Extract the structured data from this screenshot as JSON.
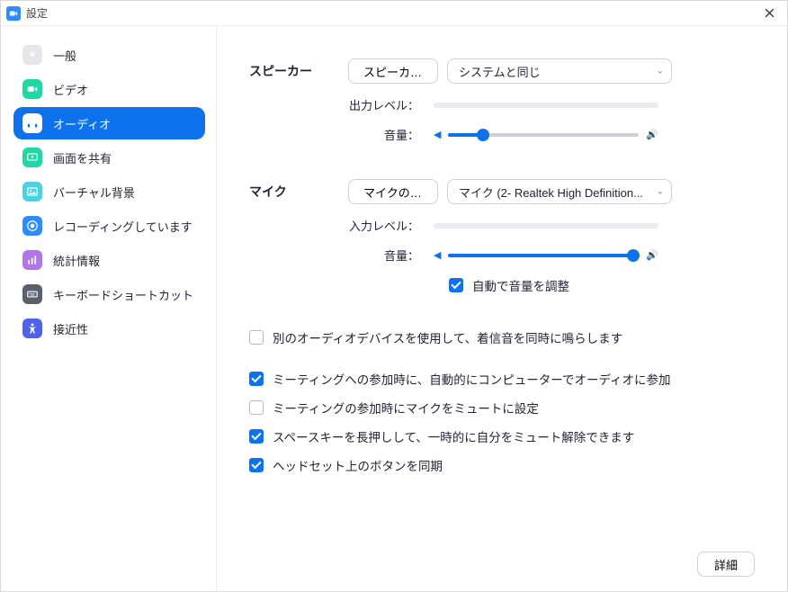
{
  "titlebar": {
    "title": "設定"
  },
  "sidebar": {
    "items": [
      {
        "label": "一般"
      },
      {
        "label": "ビデオ"
      },
      {
        "label": "オーディオ"
      },
      {
        "label": "画面を共有"
      },
      {
        "label": "バーチャル背景"
      },
      {
        "label": "レコーディングしています"
      },
      {
        "label": "統計情報"
      },
      {
        "label": "キーボードショートカット"
      },
      {
        "label": "接近性"
      }
    ]
  },
  "speaker": {
    "section": "スピーカー",
    "testButton": "スピーカー...",
    "device": "システムと同じ",
    "outputLevelLabel": "出力レベル：",
    "volumeLabel": "音量：",
    "volume": 18
  },
  "mic": {
    "section": "マイク",
    "testButton": "マイクのテ...",
    "device": "マイク (2- Realtek High Definition...",
    "inputLevelLabel": "入力レベル：",
    "volumeLabel": "音量：",
    "volume": 97,
    "autoAdjust": {
      "checked": true,
      "label": "自動で音量を調整"
    }
  },
  "options": {
    "ringSeparate": {
      "checked": false,
      "label": "別のオーディオデバイスを使用して、着信音を同時に鳴らします"
    },
    "autoJoin": {
      "checked": true,
      "label": "ミーティングへの参加時に、自動的にコンピューターでオーディオに参加"
    },
    "muteOnJoin": {
      "checked": false,
      "label": "ミーティングの参加時にマイクをミュートに設定"
    },
    "pushToTalk": {
      "checked": true,
      "label": "スペースキーを長押しして、一時的に自分をミュート解除できます"
    },
    "syncHeadset": {
      "checked": true,
      "label": "ヘッドセット上のボタンを同期"
    }
  },
  "footer": {
    "detail": "詳細"
  }
}
